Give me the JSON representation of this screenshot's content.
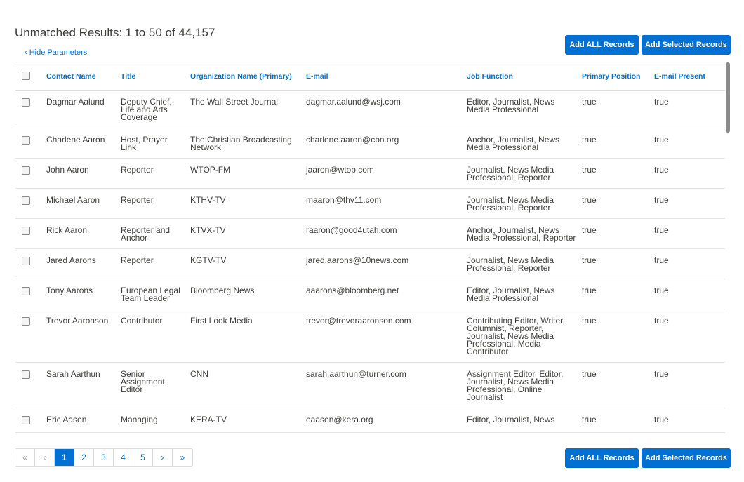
{
  "header": {
    "title": "Unmatched Results: 1 to 50 of 44,157",
    "hide_params": "‹ Hide Parameters"
  },
  "actions": {
    "add_all": "Add ALL Records",
    "add_selected": "Add Selected Records"
  },
  "columns": [
    "Contact Name",
    "Title",
    "Organization Name (Primary)",
    "E-mail",
    "Job Function",
    "Primary Position",
    "E-mail Present"
  ],
  "rows": [
    {
      "name": "Dagmar Aalund",
      "title": "Deputy Chief, Life and Arts Coverage",
      "org": "The Wall Street Journal",
      "email": "dagmar.aalund@wsj.com",
      "job": "Editor, Journalist, News Media Professional",
      "primary": "true",
      "email_present": "true"
    },
    {
      "name": "Charlene Aaron",
      "title": "Host, Prayer Link",
      "org": "The Christian Broadcasting Network",
      "email": "charlene.aaron@cbn.org",
      "job": "Anchor, Journalist, News Media Professional",
      "primary": "true",
      "email_present": "true"
    },
    {
      "name": "John Aaron",
      "title": "Reporter",
      "org": "WTOP-FM",
      "email": "jaaron@wtop.com",
      "job": "Journalist, News Media Professional, Reporter",
      "primary": "true",
      "email_present": "true"
    },
    {
      "name": "Michael Aaron",
      "title": "Reporter",
      "org": "KTHV-TV",
      "email": "maaron@thv11.com",
      "job": "Journalist, News Media Professional, Reporter",
      "primary": "true",
      "email_present": "true"
    },
    {
      "name": "Rick Aaron",
      "title": "Reporter and Anchor",
      "org": "KTVX-TV",
      "email": "raaron@good4utah.com",
      "job": "Anchor, Journalist, News Media Professional, Reporter",
      "primary": "true",
      "email_present": "true"
    },
    {
      "name": "Jared Aarons",
      "title": "Reporter",
      "org": "KGTV-TV",
      "email": "jared.aarons@10news.com",
      "job": "Journalist, News Media Professional, Reporter",
      "primary": "true",
      "email_present": "true"
    },
    {
      "name": "Tony Aarons",
      "title": "European Legal Team Leader",
      "org": "Bloomberg News",
      "email": "aaarons@bloomberg.net",
      "job": "Editor, Journalist, News Media Professional",
      "primary": "true",
      "email_present": "true"
    },
    {
      "name": "Trevor Aaronson",
      "title": "Contributor",
      "org": "First Look Media",
      "email": "trevor@trevoraaronson.com",
      "job": "Contributing Editor, Writer, Columnist, Reporter, Journalist, News Media Professional, Media Contributor",
      "primary": "true",
      "email_present": "true"
    },
    {
      "name": "Sarah Aarthun",
      "title": "Senior Assignment Editor",
      "org": "CNN",
      "email": "sarah.aarthun@turner.com",
      "job": "Assignment Editor, Editor, Journalist, News Media Professional, Online Journalist",
      "primary": "true",
      "email_present": "true"
    },
    {
      "name": "Eric Aasen",
      "title": "Managing",
      "org": "KERA-TV",
      "email": "eaasen@kera.org",
      "job": "Editor, Journalist, News",
      "primary": "true",
      "email_present": "true"
    }
  ],
  "pagination": {
    "first": "«",
    "prev": "‹",
    "pages": [
      "1",
      "2",
      "3",
      "4",
      "5"
    ],
    "next": "›",
    "last": "»"
  }
}
